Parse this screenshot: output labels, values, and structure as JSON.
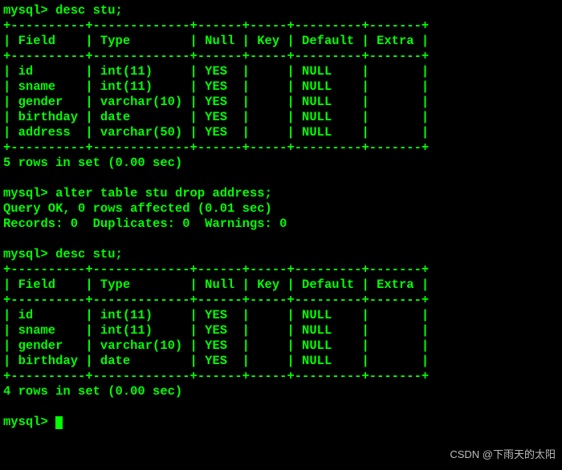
{
  "prompt": "mysql> ",
  "cmd1": "desc stu;",
  "border1": "+----------+-------------+------+-----+---------+-------+",
  "header1": "| Field    | Type        | Null | Key | Default | Extra |",
  "t1r1": "| id       | int(11)     | YES  |     | NULL    |       |",
  "t1r2": "| sname    | int(11)     | YES  |     | NULL    |       |",
  "t1r3": "| gender   | varchar(10) | YES  |     | NULL    |       |",
  "t1r4": "| birthday | date        | YES  |     | NULL    |       |",
  "t1r5": "| address  | varchar(50) | YES  |     | NULL    |       |",
  "result1": "5 rows in set (0.00 sec)",
  "cmd2": "alter table stu drop address;",
  "q_ok": "Query OK, 0 rows affected (0.01 sec)",
  "records": "Records: 0  Duplicates: 0  Warnings: 0",
  "cmd3": "desc stu;",
  "t2r1": "| id       | int(11)     | YES  |     | NULL    |       |",
  "t2r2": "| sname    | int(11)     | YES  |     | NULL    |       |",
  "t2r3": "| gender   | varchar(10) | YES  |     | NULL    |       |",
  "t2r4": "| birthday | date        | YES  |     | NULL    |       |",
  "result2": "4 rows in set (0.00 sec)",
  "watermark": "CSDN @下雨天的太阳"
}
